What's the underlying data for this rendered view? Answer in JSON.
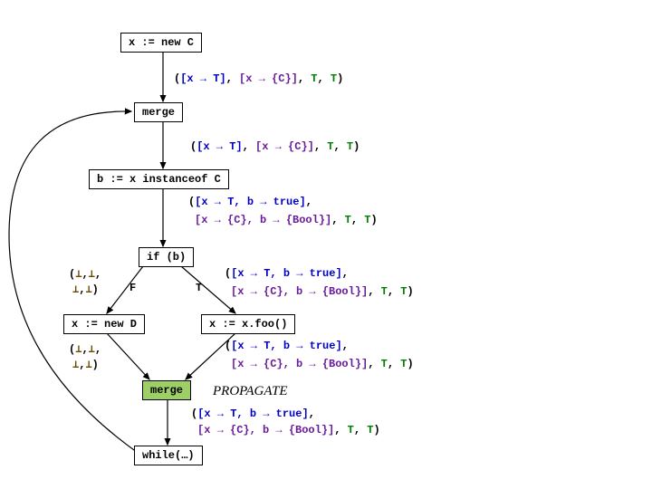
{
  "nodes": {
    "new_c": "x := new C",
    "merge1": "merge",
    "instanceof": "b := x instanceof C",
    "ifb": "if (b)",
    "new_d": "x := new D",
    "foo": "x := x.foo()",
    "merge2": "merge",
    "whilenode": "while(…)"
  },
  "edges": {
    "f": "F",
    "t": "T"
  },
  "propagate": "PROPAGATE",
  "annots": {
    "a1": {
      "pre": "(",
      "b1": "[x → T]",
      "mid1": ", ",
      "p1": "[x → {C}]",
      "mid2": ", ",
      "g1": "T",
      "mid3": ", ",
      "g2": "T",
      "post": ")"
    },
    "a2": {
      "pre": "(",
      "b1": "[x → T]",
      "mid1": ", ",
      "p1": "[x → {C}]",
      "mid2": ", ",
      "g1": "T",
      "mid3": ", ",
      "g2": "T",
      "post": ")"
    },
    "a3": {
      "pre": "(",
      "b1": "[x → T,",
      "sp1": "   ",
      "b2": "b → true]",
      "mid1": ",",
      "nl": "",
      "sp2": " ",
      "p1": "[x → {C}, b → {Bool}]",
      "mid2": ", ",
      "g1": "T",
      "mid3": ", ",
      "g2": "T",
      "post": ")"
    },
    "a4": {
      "pre": "(",
      "b1": "[x → T,",
      "sp1": "   ",
      "b2": "b → true]",
      "mid1": ",",
      "sp2": " ",
      "p1": "[x → {C}, b → {Bool}]",
      "mid2": ", ",
      "g1": "T",
      "mid3": ", ",
      "g2": "T",
      "post": ")"
    },
    "a5_left1": {
      "pre": "(",
      "bot1": "⊥",
      "mid1": ",",
      "bot2": "⊥",
      "mid2": ",",
      "bot3": "⊥",
      "mid3": ",",
      "bot4": "⊥",
      "post": ")"
    },
    "a5_left2": {
      "pre": "(",
      "bot1": "⊥",
      "mid1": ",",
      "bot2": "⊥",
      "mid2": ",",
      "bot3": "⊥",
      "mid3": ",",
      "bot4": "⊥",
      "post": ")"
    },
    "a6": {
      "pre": "(",
      "b1": "[x → T,",
      "sp1": "   ",
      "b2": "b → true]",
      "mid1": ",",
      "sp2": " ",
      "p1": "[x → {C}, b → {Bool}]",
      "mid2": ", ",
      "g1": "T",
      "mid3": ", ",
      "g2": "T",
      "post": ")"
    },
    "a7": {
      "pre": "(",
      "b1": "[x → T,",
      "sp1": "   ",
      "b2": "b → true]",
      "mid1": ",",
      "sp2": " ",
      "p1": "[x → {C}, b → {Bool}]",
      "mid2": ", ",
      "g1": "T",
      "mid3": ", ",
      "g2": "T",
      "post": ")"
    }
  }
}
